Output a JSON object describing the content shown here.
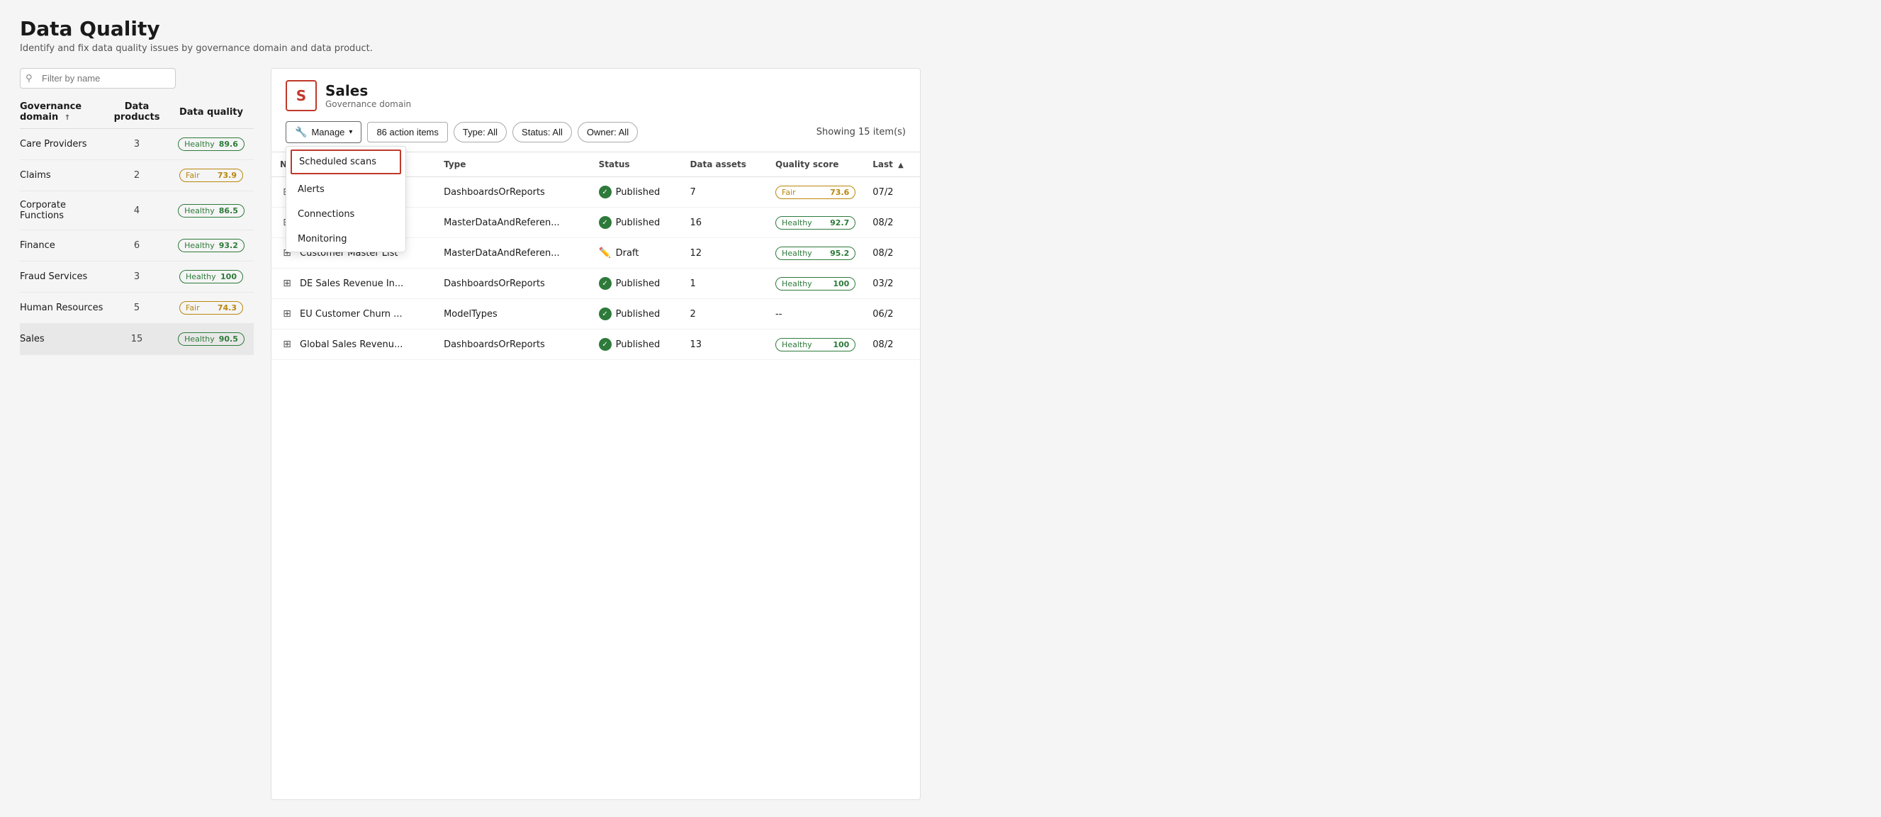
{
  "page": {
    "title": "Data Quality",
    "subtitle": "Identify and fix data quality issues by governance domain and data product."
  },
  "filter": {
    "placeholder": "Filter by name"
  },
  "left_table": {
    "headers": {
      "domain": "Governance domain",
      "products": "Data products",
      "quality": "Data quality"
    },
    "rows": [
      {
        "name": "Care Providers",
        "products": 3,
        "quality_label": "Healthy",
        "quality_score": "89.6",
        "badge_type": "healthy"
      },
      {
        "name": "Claims",
        "products": 2,
        "quality_label": "Fair",
        "quality_score": "73.9",
        "badge_type": "fair"
      },
      {
        "name": "Corporate Functions",
        "products": 4,
        "quality_label": "Healthy",
        "quality_score": "86.5",
        "badge_type": "healthy"
      },
      {
        "name": "Finance",
        "products": 6,
        "quality_label": "Healthy",
        "quality_score": "93.2",
        "badge_type": "healthy"
      },
      {
        "name": "Fraud Services",
        "products": 3,
        "quality_label": "Healthy",
        "quality_score": "100",
        "badge_type": "healthy"
      },
      {
        "name": "Human Resources",
        "products": 5,
        "quality_label": "Fair",
        "quality_score": "74.3",
        "badge_type": "fair"
      },
      {
        "name": "Sales",
        "products": 15,
        "quality_label": "Healthy",
        "quality_score": "90.5",
        "badge_type": "healthy"
      }
    ]
  },
  "right_panel": {
    "domain_label": "S",
    "domain_name": "Sales",
    "domain_type": "Governance domain",
    "toolbar": {
      "manage_label": "Manage",
      "action_items_label": "86 action items",
      "type_filter": "Type: All",
      "status_filter": "Status: All",
      "owner_filter": "Owner: All",
      "showing_text": "Showing 15 item(s)"
    },
    "dropdown": {
      "items": [
        {
          "label": "Scheduled scans",
          "highlighted": true
        },
        {
          "label": "Alerts",
          "highlighted": false
        },
        {
          "label": "Connections",
          "highlighted": false
        },
        {
          "label": "Monitoring",
          "highlighted": false
        }
      ]
    },
    "table": {
      "headers": {
        "name": "Name",
        "type": "Type",
        "status": "Status",
        "data_assets": "Data assets",
        "quality_score": "Quality score",
        "last": "Last"
      },
      "rows": [
        {
          "name": "",
          "type": "DashboardsOrReports",
          "status": "Published",
          "status_type": "published",
          "data_assets": 7,
          "quality_label": "Fair",
          "quality_score": "73.6",
          "badge_type": "fair",
          "last": "07/2"
        },
        {
          "name": "",
          "type": "MasterDataAndReferen...",
          "status": "Published",
          "status_type": "published",
          "data_assets": 16,
          "quality_label": "Healthy",
          "quality_score": "92.7",
          "badge_type": "healthy",
          "last": "08/2"
        },
        {
          "name": "Customer Master List",
          "type": "MasterDataAndReferen...",
          "status": "Draft",
          "status_type": "draft",
          "data_assets": 12,
          "quality_label": "Healthy",
          "quality_score": "95.2",
          "badge_type": "healthy",
          "last": "08/2"
        },
        {
          "name": "DE Sales Revenue In...",
          "type": "DashboardsOrReports",
          "status": "Published",
          "status_type": "published",
          "data_assets": 1,
          "quality_label": "Healthy",
          "quality_score": "100",
          "badge_type": "healthy",
          "last": "03/2"
        },
        {
          "name": "EU Customer Churn ...",
          "type": "ModelTypes",
          "status": "Published",
          "status_type": "published",
          "data_assets": 2,
          "quality_label": "--",
          "quality_score": "",
          "badge_type": "none",
          "last": "06/2"
        },
        {
          "name": "Global Sales Revenu...",
          "type": "DashboardsOrReports",
          "status": "Published",
          "status_type": "published",
          "data_assets": 13,
          "quality_label": "Healthy",
          "quality_score": "100",
          "badge_type": "healthy",
          "last": "08/2"
        }
      ]
    }
  }
}
